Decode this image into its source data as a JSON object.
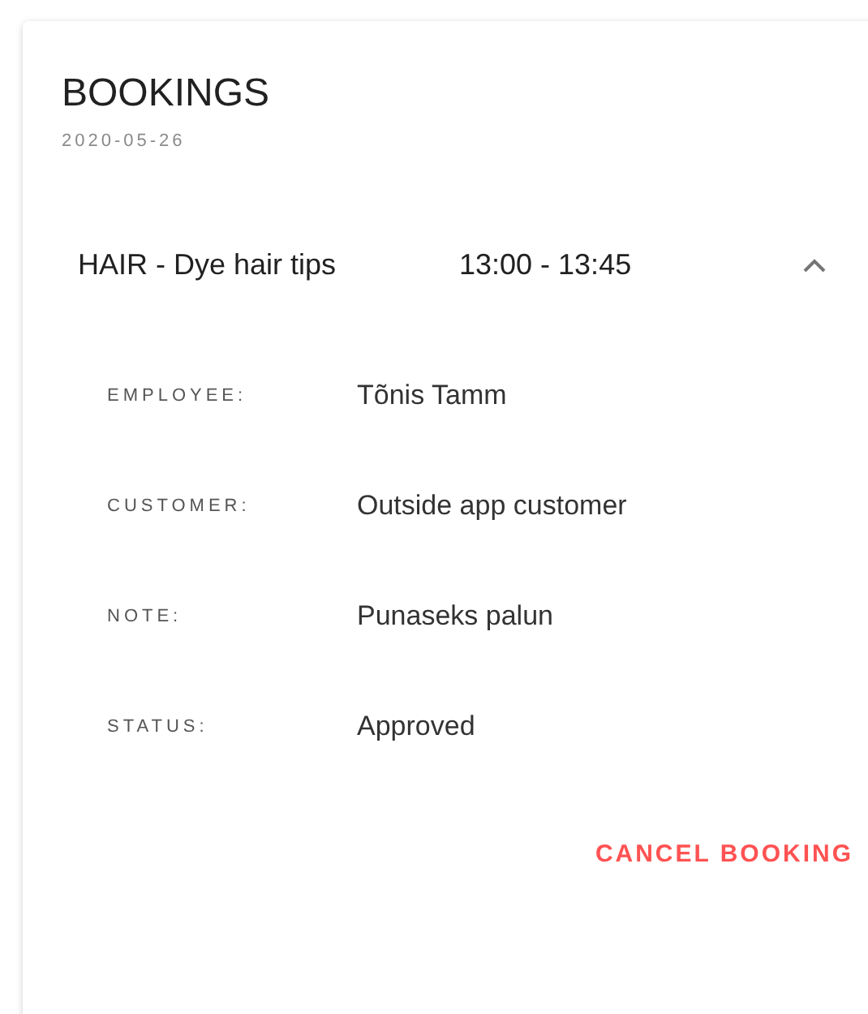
{
  "card": {
    "title": "BOOKINGS",
    "date": "2020-05-26",
    "bookings": [
      {
        "service": "HAIR - Dye hair tips",
        "time": "13:00 - 13:45",
        "expanded": true,
        "details": [
          {
            "label": "EMPLOYEE:",
            "value": "Tõnis Tamm"
          },
          {
            "label": "CUSTOMER:",
            "value": "Outside app customer"
          },
          {
            "label": "NOTE:",
            "value": "Punaseks palun"
          },
          {
            "label": "STATUS:",
            "value": "Approved"
          }
        ],
        "action": "CANCEL BOOKING"
      }
    ]
  }
}
